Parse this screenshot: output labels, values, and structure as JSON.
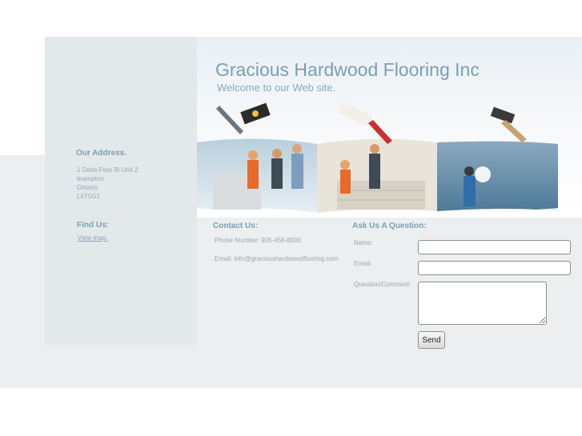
{
  "header": {
    "title": "Gracious Hardwood Flooring Inc",
    "subtitle": "Welcome to our Web site."
  },
  "sidebar": {
    "address_heading": "Our Address.",
    "address_lines": [
      "1 Delta Park Bl Unit 2",
      "brampton",
      "Ontario",
      "L6T5G1"
    ],
    "find_heading": "Find Us:",
    "map_link": "View map."
  },
  "contact": {
    "heading": "Contact Us:",
    "phone": "Phone Number: 905-458-8000",
    "email": "Email: info@gracioushardwoodflooring.com"
  },
  "form": {
    "heading": "Ask Us A Question:",
    "name_label": "Name:",
    "email_label": "Email:",
    "question_label": "Question/Comment:",
    "name_value": "",
    "email_value": "",
    "question_value": "",
    "send_label": "Send"
  },
  "colors": {
    "title": "#7a9fb4",
    "sidebar_bg": "#e3e8eb",
    "band_bg": "#eceeef",
    "heading": "#7e9fb1"
  }
}
